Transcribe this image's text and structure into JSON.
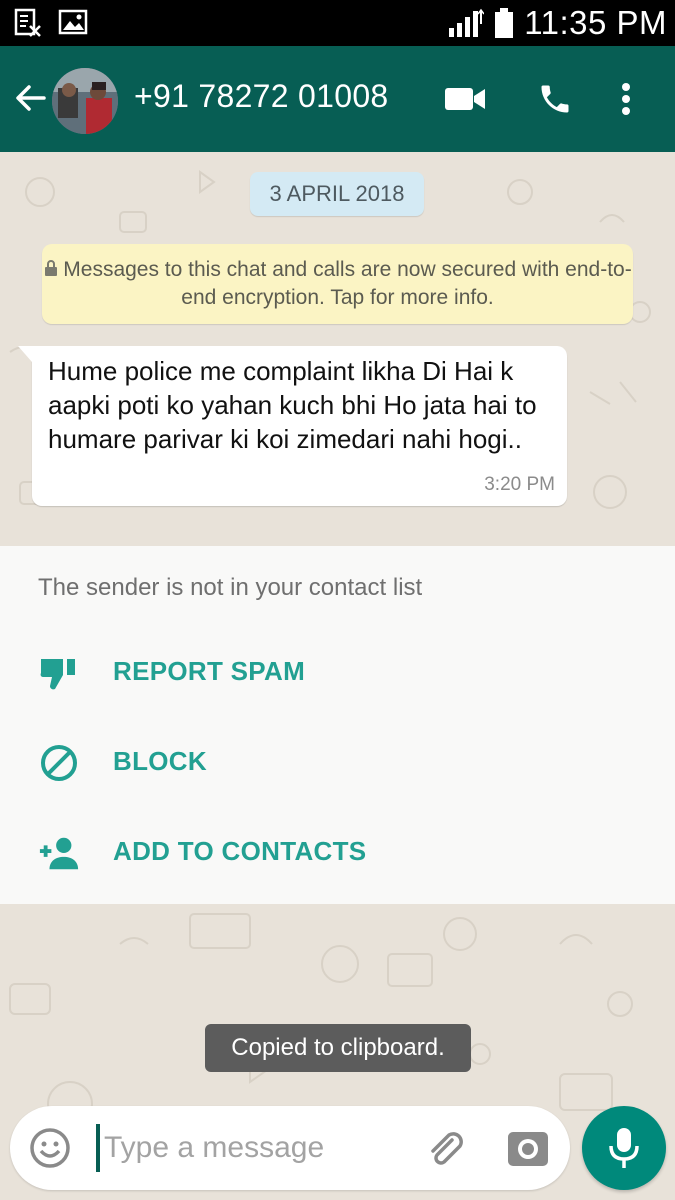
{
  "status_bar": {
    "time": "11:35 PM",
    "icons": [
      "sim-no-service-icon",
      "image-notification-icon",
      "signal-icon",
      "battery-icon"
    ]
  },
  "header": {
    "contact": "+91 78272 01008",
    "icons": [
      "back-arrow-icon",
      "avatar",
      "video-call-icon",
      "voice-call-icon",
      "more-options-icon"
    ],
    "color": "#075e54"
  },
  "chat": {
    "date": "3 APRIL 2018",
    "encryption_notice": "Messages to this chat and calls are now secured with end-to-end encryption. Tap for more info.",
    "message": {
      "text": "Hume police me complaint likha Di Hai k aapki poti ko yahan kuch bhi Ho jata hai to humare parivar ki koi zimedari nahi hogi..",
      "time": "3:20 PM"
    }
  },
  "spam_panel": {
    "note": "The sender is not in your contact list",
    "actions": [
      {
        "label": "REPORT SPAM",
        "icon": "thumbs-down-icon"
      },
      {
        "label": "BLOCK",
        "icon": "block-icon"
      },
      {
        "label": "ADD TO CONTACTS",
        "icon": "add-contact-icon"
      }
    ],
    "accent": "#22a092"
  },
  "toast": "Copied to clipboard.",
  "composer": {
    "placeholder": "Type a message",
    "value": "",
    "icons": [
      "emoji-icon",
      "attach-icon",
      "camera-icon",
      "mic-icon"
    ],
    "send_color": "#00897b"
  }
}
